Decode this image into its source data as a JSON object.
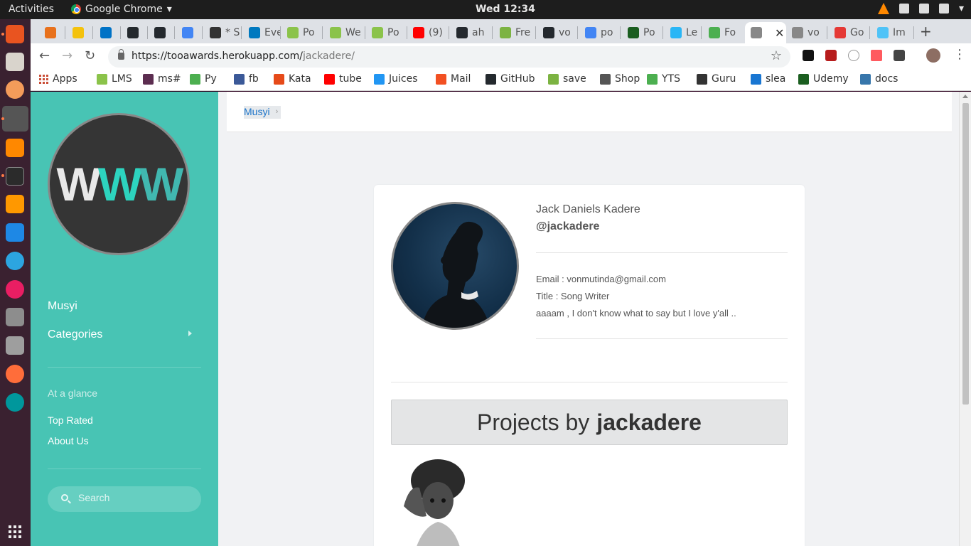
{
  "system": {
    "activities": "Activities",
    "app_name": "Google Chrome",
    "app_menu_arrow": "▾",
    "clock": "Wed 12:34"
  },
  "tabs": [
    {
      "label": "",
      "color": "#e8711c"
    },
    {
      "label": "",
      "color": "#f4c20d"
    },
    {
      "label": "",
      "color": "#0072c6"
    },
    {
      "label": "",
      "color": "#24292e"
    },
    {
      "label": "",
      "color": "#24292e"
    },
    {
      "label": "",
      "color": "#4285f4"
    },
    {
      "label": "* S",
      "color": "#333"
    },
    {
      "label": "Eve",
      "color": "#0079bf"
    },
    {
      "label": "Po",
      "color": "#8bc34a"
    },
    {
      "label": "We",
      "color": "#8bc34a"
    },
    {
      "label": "Po",
      "color": "#8bc34a"
    },
    {
      "label": "(9)",
      "color": "#ff0000"
    },
    {
      "label": "ah",
      "color": "#24292e"
    },
    {
      "label": "Fre",
      "color": "#7cb342"
    },
    {
      "label": "vo",
      "color": "#24292e"
    },
    {
      "label": "po",
      "color": "#4285f4"
    },
    {
      "label": "Po",
      "color": "#1b5e20"
    },
    {
      "label": "Le",
      "color": "#29b6f6"
    },
    {
      "label": "Fo",
      "color": "#4caf50"
    },
    {
      "label": "",
      "color": "#888",
      "active": true,
      "close": "✕"
    },
    {
      "label": "vo",
      "color": "#888"
    },
    {
      "label": "Go",
      "color": "#e53935"
    },
    {
      "label": "Im",
      "color": "#4fc3f7"
    }
  ],
  "new_tab_label": "+",
  "toolbar": {
    "back": "←",
    "forward": "→",
    "reload": "↻",
    "url_host": "https://tooawards.herokuapp.com/",
    "url_path": "jackadere/",
    "bookmark_star": "☆"
  },
  "bookmarks": [
    {
      "label": "Apps",
      "color": "#c94d36"
    },
    {
      "label": "LMS",
      "color": "#8bc34a"
    },
    {
      "label": "ms#",
      "color": "#5c2d50"
    },
    {
      "label": "Py",
      "color": "#4caf50"
    },
    {
      "label": "fb",
      "color": "#3b5998"
    },
    {
      "label": "Kata",
      "color": "#e64a19"
    },
    {
      "label": "tube",
      "color": "#ff0000"
    },
    {
      "label": "Juices",
      "color": "#2196f3"
    },
    {
      "label": "Mail",
      "color": "#f25022"
    },
    {
      "label": "GitHub",
      "color": "#24292e"
    },
    {
      "label": "save",
      "color": "#7cb342"
    },
    {
      "label": "Shop",
      "color": "#555"
    },
    {
      "label": "YTS",
      "color": "#4caf50"
    },
    {
      "label": "Guru",
      "color": "#333"
    },
    {
      "label": "slea",
      "color": "#1976d2"
    },
    {
      "label": "Udemy",
      "color": "#1b5e20"
    },
    {
      "label": "docs",
      "color": "#3776ab"
    }
  ],
  "sidebar": {
    "brand": "Musyi",
    "categories": "Categories",
    "section_label": "At a glance",
    "top_rated": "Top Rated",
    "about_us": "About Us",
    "search_placeholder": "Search"
  },
  "breadcrumb": {
    "item": "Musyi",
    "chevron": "›"
  },
  "profile": {
    "name": "Jack Daniels Kadere",
    "handle": "@jackadere",
    "email_line": "Email : vonmutinda@gmail.com",
    "title_line": "Title : Song Writer",
    "bio": "aaaam , I don't know what to say but I love y'all ..",
    "projects_prefix": "Projects by",
    "projects_user": "jackadere"
  }
}
